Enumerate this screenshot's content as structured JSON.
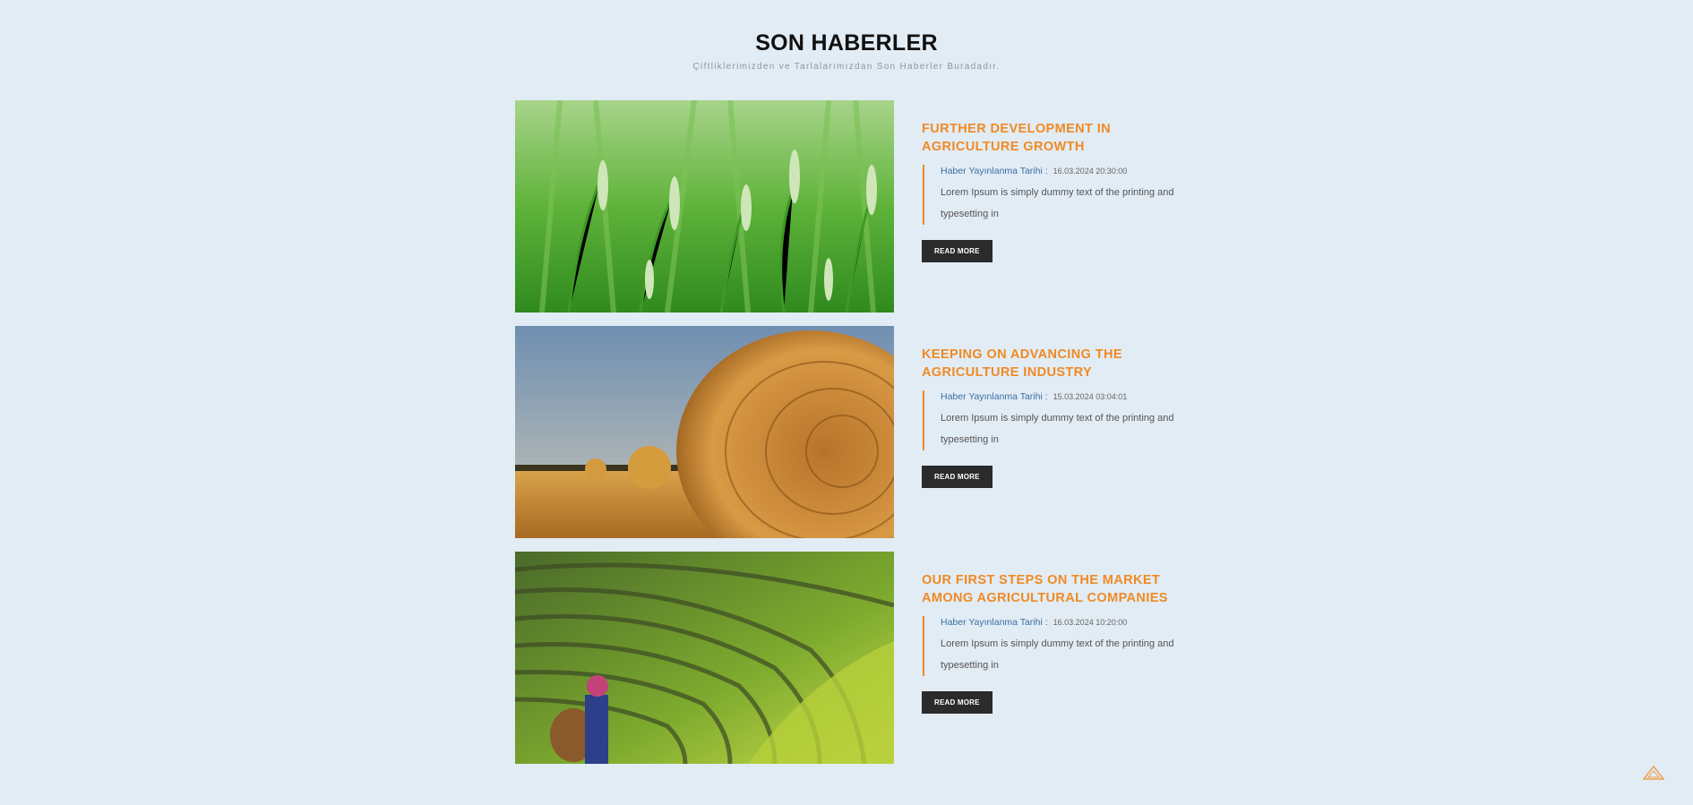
{
  "header": {
    "title": "SON HABERLER",
    "subtitle": "Çiftliklerimizden ve Tarlalarımızdan Son Haberler Buradadır."
  },
  "news": [
    {
      "title": "FURTHER DEVELOPMENT IN AGRICULTURE GROWTH",
      "date_label": "Haber Yayınlanma Tarihi :",
      "date": "16.03.2024 20:30:00",
      "excerpt": "Lorem Ipsum is simply dummy text of the printing and typesetting in",
      "button": "READ MORE",
      "image": "wheat-field-photo"
    },
    {
      "title": "KEEPING ON ADVANCING THE AGRICULTURE INDUSTRY",
      "date_label": "Haber Yayınlanma Tarihi :",
      "date": "15.03.2024 03:04:01",
      "excerpt": "Lorem Ipsum is simply dummy text of the printing and typesetting in",
      "button": "READ MORE",
      "image": "hay-bales-photo"
    },
    {
      "title": "OUR FIRST STEPS ON THE MARKET AMONG AGRICULTURAL COMPANIES",
      "date_label": "Haber Yayınlanma Tarihi :",
      "date": "16.03.2024 10:20:00",
      "excerpt": "Lorem Ipsum is simply dummy text of the printing and typesetting in",
      "button": "READ MORE",
      "image": "rice-terraces-photo"
    }
  ],
  "scroll_top": {
    "icon": "triangle-up-icon"
  },
  "colors": {
    "background": "#e2ecf4",
    "accent": "#f08a24",
    "button": "#2b2b2b",
    "link": "#3a6ea5"
  }
}
